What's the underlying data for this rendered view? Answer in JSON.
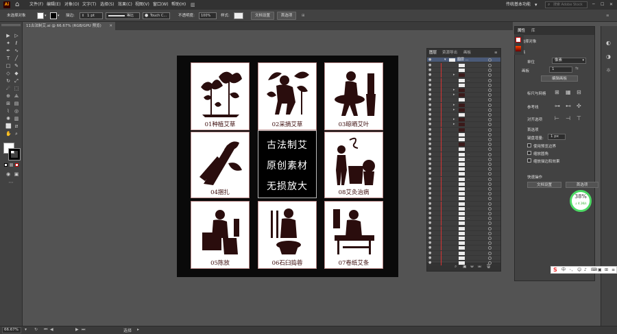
{
  "menubar": {
    "logo": "Ai",
    "items": [
      "文件(F)",
      "编辑(E)",
      "对象(O)",
      "文字(T)",
      "选择(S)",
      "效果(C)",
      "视图(V)",
      "窗口(W)",
      "帮助(H)"
    ],
    "workspace": "传统基本功能",
    "search_placeholder": "搜索 Adobe Stock"
  },
  "control": {
    "no_selection": "未选择对象",
    "stroke_label": "描边:",
    "stroke_value": "1 pt",
    "stroke_style": "等比",
    "brush": "Touch C...",
    "opacity_label": "不透明度:",
    "opacity_value": "100%",
    "style_label": "样式:",
    "doc_setup": "文档设置",
    "prefs": "首选项"
  },
  "document": {
    "tab_title": "11古法制艾.ai @ 66.67% (RGB/GPU 预览)",
    "zoom": "66.67%",
    "status_tool": "选择"
  },
  "artboard": {
    "tiles": [
      {
        "caption": "01种植艾草"
      },
      {
        "caption": "02采摘艾草"
      },
      {
        "caption": "03晾晒艾叶"
      },
      {
        "caption": "04捆扎"
      },
      {
        "caption": "08艾灸治病"
      },
      {
        "caption": "05陈放"
      },
      {
        "caption": "06石臼捣蓉"
      },
      {
        "caption": "07卷纸艾条"
      }
    ],
    "center": {
      "line1": "古法制艾",
      "line2": "原创素材",
      "line3": "无损放大"
    }
  },
  "layers_panel": {
    "tabs": [
      "图层",
      "资源导出",
      "画板"
    ],
    "top_layer": "图层 ..."
  },
  "properties_panel": {
    "tabs": [
      "属性",
      "库"
    ],
    "no_selection": "未选择对象",
    "doc_section": "文档",
    "unit_label": "单位",
    "unit_value": "像素",
    "artboard_label": "画板",
    "artboard_value": "1",
    "edit_artboard": "编辑画板",
    "rulers_grid": "标尺与网格",
    "guides": "参考线",
    "snap": "对齐选项",
    "prefs_section": "首选项",
    "keyboard_increment_label": "键盘增量:",
    "keyboard_increment_value": "1 px",
    "check_preview_bounds": "使用预览边界",
    "check_scale_corners": "缩放圆角",
    "check_scale_strokes": "缩放描边和效果",
    "quick_actions": "快速操作",
    "doc_setup_btn": "文档设置",
    "prefs_btn": "首选项"
  },
  "gauge": {
    "percent": "38%",
    "speed": "↓ 4.1K/s"
  },
  "ime": {
    "label": "中"
  }
}
